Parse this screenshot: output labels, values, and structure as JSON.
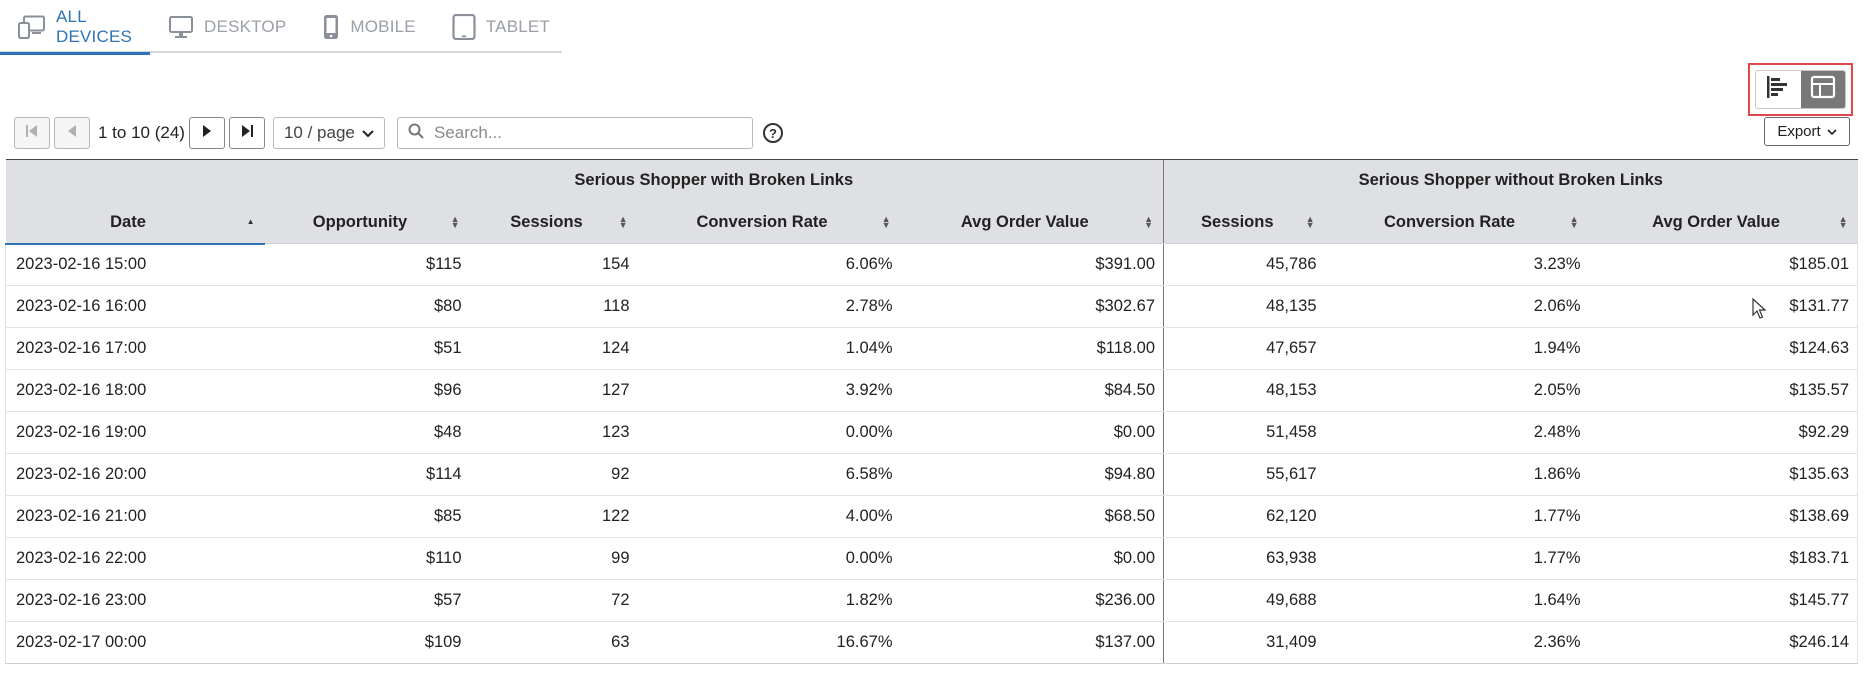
{
  "tabs": [
    {
      "label": "ALL DEVICES",
      "icon": "all-devices-icon",
      "active": true
    },
    {
      "label": "DESKTOP",
      "icon": "desktop-icon",
      "active": false
    },
    {
      "label": "MOBILE",
      "icon": "mobile-icon",
      "active": false
    },
    {
      "label": "TABLET",
      "icon": "tablet-icon",
      "active": false
    }
  ],
  "view_toggle": {
    "options": [
      "bar-chart-icon",
      "table-layout-icon"
    ],
    "selected": "table-layout-icon"
  },
  "pagination": {
    "range_text": "1 to 10 (24)",
    "page_size": "10 / page"
  },
  "search": {
    "placeholder": "Search...",
    "value": ""
  },
  "export": {
    "label": "Export"
  },
  "table": {
    "groups": [
      "Serious Shopper with Broken Links",
      "Serious Shopper without Broken Links"
    ],
    "columns": [
      "Date",
      "Opportunity",
      "Sessions",
      "Conversion Rate",
      "Avg Order Value",
      "Sessions",
      "Conversion Rate",
      "Avg Order Value"
    ],
    "rows": [
      [
        "2023-02-16 15:00",
        "$115",
        "154",
        "6.06%",
        "$391.00",
        "45,786",
        "3.23%",
        "$185.01"
      ],
      [
        "2023-02-16 16:00",
        "$80",
        "118",
        "2.78%",
        "$302.67",
        "48,135",
        "2.06%",
        "$131.77"
      ],
      [
        "2023-02-16 17:00",
        "$51",
        "124",
        "1.04%",
        "$118.00",
        "47,657",
        "1.94%",
        "$124.63"
      ],
      [
        "2023-02-16 18:00",
        "$96",
        "127",
        "3.92%",
        "$84.50",
        "48,153",
        "2.05%",
        "$135.57"
      ],
      [
        "2023-02-16 19:00",
        "$48",
        "123",
        "0.00%",
        "$0.00",
        "51,458",
        "2.48%",
        "$92.29"
      ],
      [
        "2023-02-16 20:00",
        "$114",
        "92",
        "6.58%",
        "$94.80",
        "55,617",
        "1.86%",
        "$135.63"
      ],
      [
        "2023-02-16 21:00",
        "$85",
        "122",
        "4.00%",
        "$68.50",
        "62,120",
        "1.77%",
        "$138.69"
      ],
      [
        "2023-02-16 22:00",
        "$110",
        "99",
        "0.00%",
        "$0.00",
        "63,938",
        "1.77%",
        "$183.71"
      ],
      [
        "2023-02-16 23:00",
        "$57",
        "72",
        "1.82%",
        "$236.00",
        "49,688",
        "1.64%",
        "$145.77"
      ],
      [
        "2023-02-17 00:00",
        "$109",
        "63",
        "16.67%",
        "$137.00",
        "31,409",
        "2.36%",
        "$246.14"
      ]
    ]
  },
  "colors": {
    "accent": "#2f73b6",
    "header_bg": "#dee0e4",
    "highlight_border": "#e0464a",
    "toggle_selected": "#787878"
  }
}
